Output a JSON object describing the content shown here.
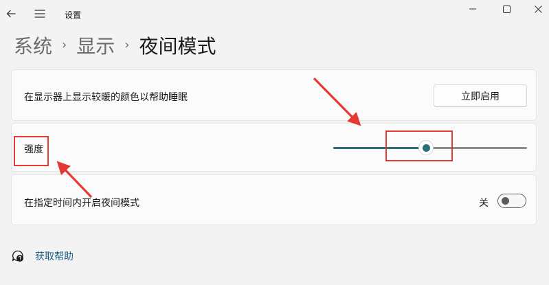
{
  "window": {
    "title": "设置"
  },
  "breadcrumb": {
    "items": [
      "系统",
      "显示"
    ],
    "separator": "›",
    "current": "夜间模式"
  },
  "night_light": {
    "description": "在显示器上显示较暖的颜色以帮助睡眠",
    "enable_button": "立即启用"
  },
  "strength": {
    "label": "强度",
    "value_fraction": 0.48
  },
  "schedule": {
    "label": "在指定时间内开启夜间模式",
    "toggle_state_label": "关",
    "toggle_on": false
  },
  "help": {
    "label": "获取帮助",
    "icon": "help-chat-icon"
  },
  "colors": {
    "accent": "#2b6f7a",
    "annotation": "#e53935",
    "link": "#1d5f87"
  }
}
